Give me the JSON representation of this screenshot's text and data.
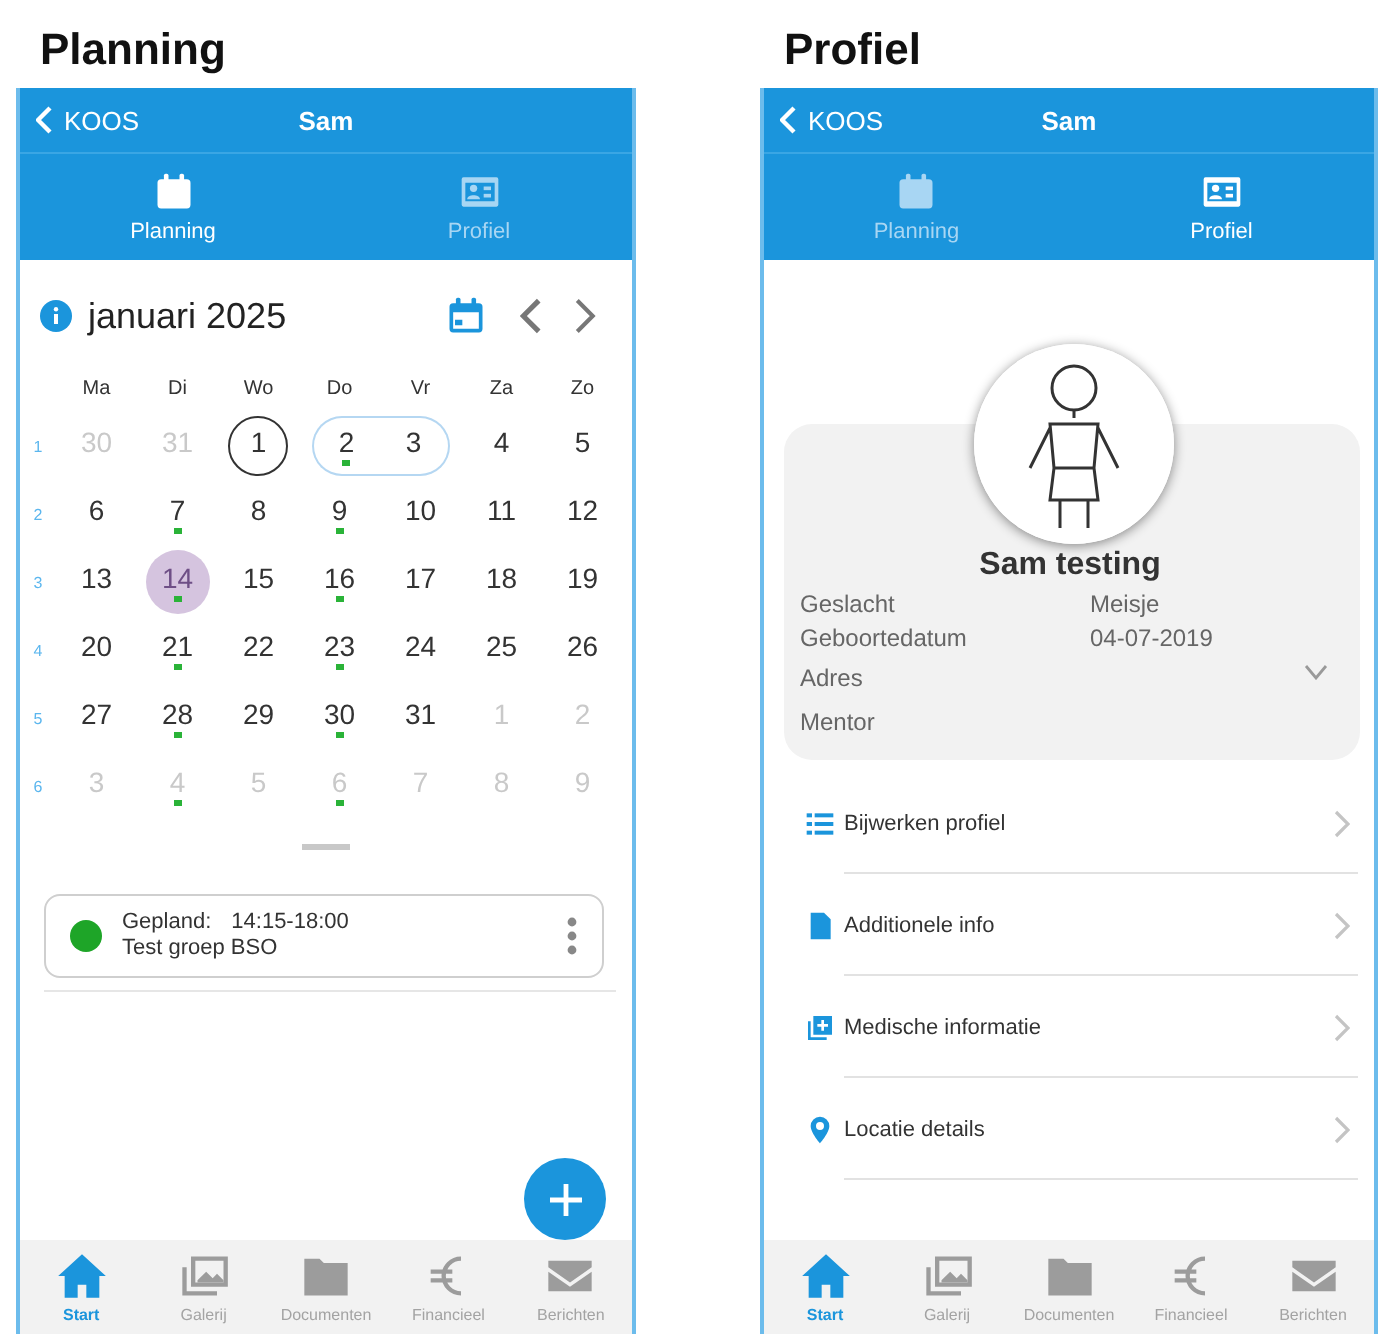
{
  "screens": [
    {
      "heading": "Planning",
      "kind": "planning",
      "nav_bar": {
        "back": "KOOS",
        "title": "Sam"
      },
      "tabs": [
        {
          "label": "Planning",
          "kind": "calendar",
          "selected": true
        },
        {
          "label": "Profiel",
          "kind": "card",
          "selected": false
        }
      ],
      "calendar": {
        "month": "januari 2025",
        "weekdays": [
          "Ma",
          "Di",
          "Wo",
          "Do",
          "Vr",
          "Za",
          "Zo"
        ],
        "weeks": [
          {
            "number": "1",
            "days": [
              {
                "label": "30",
                "muted": true,
                "today": false,
                "in_range": false,
                "selected": false,
                "dot": false
              },
              {
                "label": "31",
                "muted": true,
                "today": false,
                "in_range": false,
                "selected": false,
                "dot": false
              },
              {
                "label": "1",
                "muted": false,
                "today": true,
                "in_range": false,
                "selected": false,
                "dot": false
              },
              {
                "label": "2",
                "muted": false,
                "today": false,
                "in_range": true,
                "selected": false,
                "dot": true
              },
              {
                "label": "3",
                "muted": false,
                "today": false,
                "in_range": true,
                "selected": false,
                "dot": false
              },
              {
                "label": "4",
                "muted": false,
                "today": false,
                "in_range": false,
                "selected": false,
                "dot": false
              },
              {
                "label": "5",
                "muted": false,
                "today": false,
                "in_range": false,
                "selected": false,
                "dot": false
              }
            ]
          },
          {
            "number": "2",
            "days": [
              {
                "label": "6",
                "muted": false,
                "today": false,
                "in_range": false,
                "selected": false,
                "dot": false
              },
              {
                "label": "7",
                "muted": false,
                "today": false,
                "in_range": false,
                "selected": false,
                "dot": true
              },
              {
                "label": "8",
                "muted": false,
                "today": false,
                "in_range": false,
                "selected": false,
                "dot": false
              },
              {
                "label": "9",
                "muted": false,
                "today": false,
                "in_range": false,
                "selected": false,
                "dot": true
              },
              {
                "label": "10",
                "muted": false,
                "today": false,
                "in_range": false,
                "selected": false,
                "dot": false
              },
              {
                "label": "11",
                "muted": false,
                "today": false,
                "in_range": false,
                "selected": false,
                "dot": false
              },
              {
                "label": "12",
                "muted": false,
                "today": false,
                "in_range": false,
                "selected": false,
                "dot": false
              }
            ]
          },
          {
            "number": "3",
            "days": [
              {
                "label": "13",
                "muted": false,
                "today": false,
                "in_range": false,
                "selected": false,
                "dot": false
              },
              {
                "label": "14",
                "muted": false,
                "today": false,
                "in_range": false,
                "selected": true,
                "dot": true
              },
              {
                "label": "15",
                "muted": false,
                "today": false,
                "in_range": false,
                "selected": false,
                "dot": false
              },
              {
                "label": "16",
                "muted": false,
                "today": false,
                "in_range": false,
                "selected": false,
                "dot": true
              },
              {
                "label": "17",
                "muted": false,
                "today": false,
                "in_range": false,
                "selected": false,
                "dot": false
              },
              {
                "label": "18",
                "muted": false,
                "today": false,
                "in_range": false,
                "selected": false,
                "dot": false
              },
              {
                "label": "19",
                "muted": false,
                "today": false,
                "in_range": false,
                "selected": false,
                "dot": false
              }
            ]
          },
          {
            "number": "4",
            "days": [
              {
                "label": "20",
                "muted": false,
                "today": false,
                "in_range": false,
                "selected": false,
                "dot": false
              },
              {
                "label": "21",
                "muted": false,
                "today": false,
                "in_range": false,
                "selected": false,
                "dot": true
              },
              {
                "label": "22",
                "muted": false,
                "today": false,
                "in_range": false,
                "selected": false,
                "dot": false
              },
              {
                "label": "23",
                "muted": false,
                "today": false,
                "in_range": false,
                "selected": false,
                "dot": true
              },
              {
                "label": "24",
                "muted": false,
                "today": false,
                "in_range": false,
                "selected": false,
                "dot": false
              },
              {
                "label": "25",
                "muted": false,
                "today": false,
                "in_range": false,
                "selected": false,
                "dot": false
              },
              {
                "label": "26",
                "muted": false,
                "today": false,
                "in_range": false,
                "selected": false,
                "dot": false
              }
            ]
          },
          {
            "number": "5",
            "days": [
              {
                "label": "27",
                "muted": false,
                "today": false,
                "in_range": false,
                "selected": false,
                "dot": false
              },
              {
                "label": "28",
                "muted": false,
                "today": false,
                "in_range": false,
                "selected": false,
                "dot": true
              },
              {
                "label": "29",
                "muted": false,
                "today": false,
                "in_range": false,
                "selected": false,
                "dot": false
              },
              {
                "label": "30",
                "muted": false,
                "today": false,
                "in_range": false,
                "selected": false,
                "dot": true
              },
              {
                "label": "31",
                "muted": false,
                "today": false,
                "in_range": false,
                "selected": false,
                "dot": false
              },
              {
                "label": "1",
                "muted": true,
                "today": false,
                "in_range": false,
                "selected": false,
                "dot": false
              },
              {
                "label": "2",
                "muted": true,
                "today": false,
                "in_range": false,
                "selected": false,
                "dot": false
              }
            ]
          },
          {
            "number": "6",
            "days": [
              {
                "label": "3",
                "muted": true,
                "today": false,
                "in_range": false,
                "selected": false,
                "dot": false
              },
              {
                "label": "4",
                "muted": true,
                "today": false,
                "in_range": false,
                "selected": false,
                "dot": true
              },
              {
                "label": "5",
                "muted": true,
                "today": false,
                "in_range": false,
                "selected": false,
                "dot": false
              },
              {
                "label": "6",
                "muted": true,
                "today": false,
                "in_range": false,
                "selected": false,
                "dot": true
              },
              {
                "label": "7",
                "muted": true,
                "today": false,
                "in_range": false,
                "selected": false,
                "dot": false
              },
              {
                "label": "8",
                "muted": true,
                "today": false,
                "in_range": false,
                "selected": false,
                "dot": false
              },
              {
                "label": "9",
                "muted": true,
                "today": false,
                "in_range": false,
                "selected": false,
                "dot": false
              }
            ]
          }
        ]
      },
      "events": [
        {
          "color": "#1ea528",
          "status": "Gepland:",
          "time": "14:15-18:00",
          "group": "Test groep BSO"
        }
      ],
      "bottom_nav": [
        {
          "label": "Start",
          "kind": "home",
          "selected": true
        },
        {
          "label": "Galerij",
          "kind": "gallery",
          "selected": false
        },
        {
          "label": "Documenten",
          "kind": "folder",
          "selected": false
        },
        {
          "label": "Financieel",
          "kind": "euro",
          "selected": false
        },
        {
          "label": "Berichten",
          "kind": "mail",
          "selected": false
        }
      ]
    },
    {
      "heading": "Profiel",
      "kind": "profile",
      "nav_bar": {
        "back": "KOOS",
        "title": "Sam"
      },
      "tabs": [
        {
          "label": "Planning",
          "kind": "calendar",
          "selected": false
        },
        {
          "label": "Profiel",
          "kind": "card",
          "selected": true
        }
      ],
      "profile": {
        "name": "Sam testing",
        "fields": [
          {
            "label": "Geslacht",
            "value": "Meisje"
          },
          {
            "label": "Geboortedatum",
            "value": "04-07-2019"
          }
        ],
        "details": [
          "Adres",
          "Mentor"
        ],
        "details_expanded": false,
        "menu": [
          {
            "label": "Bijwerken profiel",
            "kind": "list"
          },
          {
            "label": "Additionele info",
            "kind": "document"
          },
          {
            "label": "Medische informatie",
            "kind": "medical"
          },
          {
            "label": "Locatie details",
            "kind": "location"
          }
        ]
      },
      "bottom_nav": [
        {
          "label": "Start",
          "kind": "home",
          "selected": true
        },
        {
          "label": "Galerij",
          "kind": "gallery",
          "selected": false
        },
        {
          "label": "Documenten",
          "kind": "folder",
          "selected": false
        },
        {
          "label": "Financieel",
          "kind": "euro",
          "selected": false
        },
        {
          "label": "Berichten",
          "kind": "mail",
          "selected": false
        }
      ]
    }
  ]
}
